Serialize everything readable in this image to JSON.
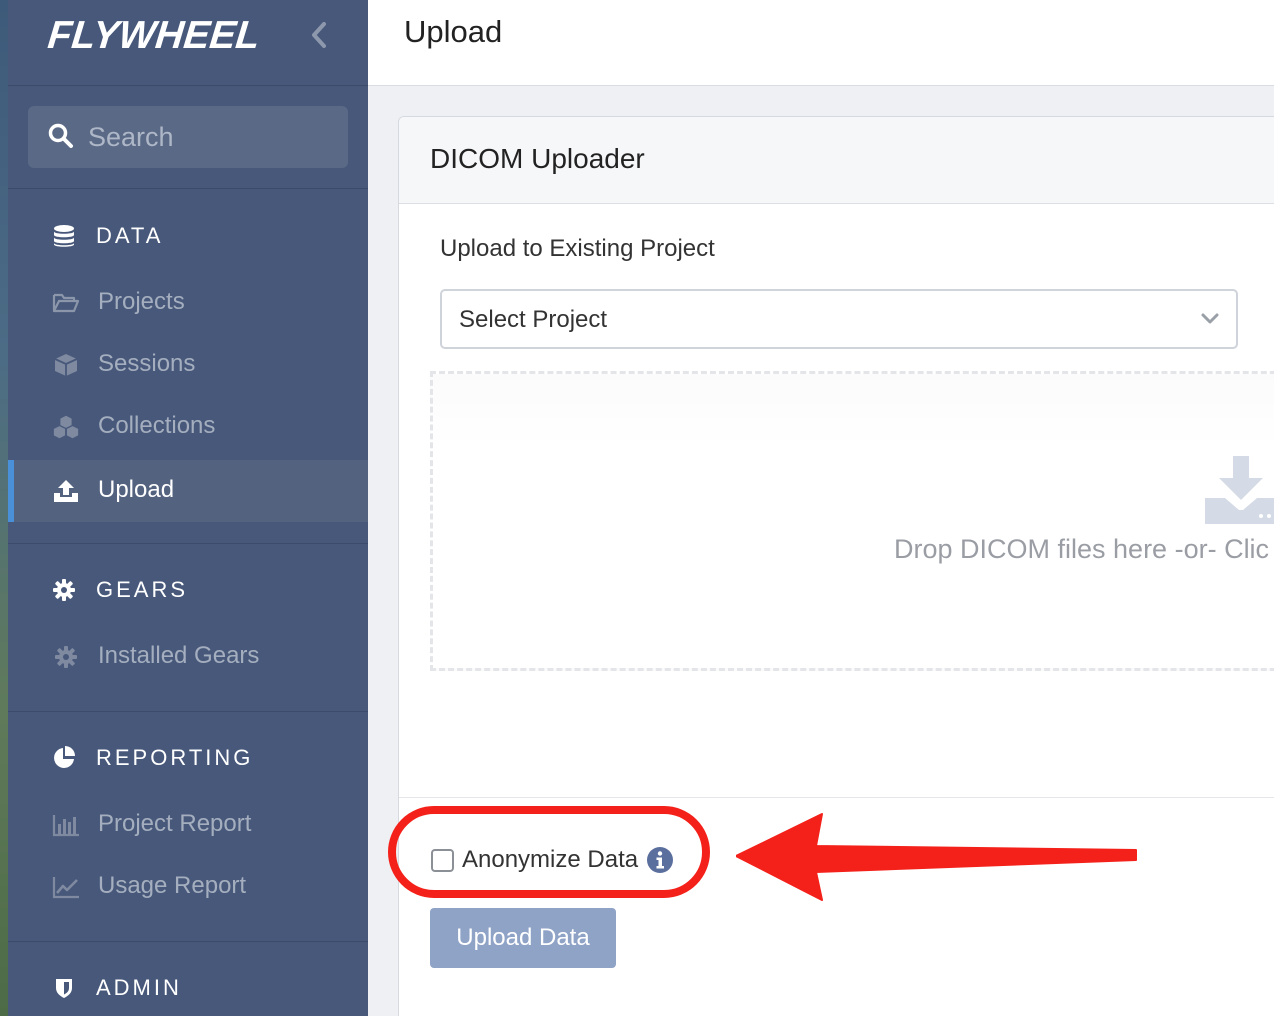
{
  "brand": {
    "logo_text": "FLYWHEEL"
  },
  "search": {
    "placeholder": "Search"
  },
  "sidebar": {
    "sections": [
      {
        "label": "DATA",
        "items": [
          {
            "label": "Projects",
            "icon": "folder-open-icon"
          },
          {
            "label": "Sessions",
            "icon": "cube-icon"
          },
          {
            "label": "Collections",
            "icon": "cubes-icon"
          },
          {
            "label": "Upload",
            "icon": "upload-icon",
            "active": true
          }
        ]
      },
      {
        "label": "GEARS",
        "items": [
          {
            "label": "Installed Gears",
            "icon": "gear-icon"
          }
        ]
      },
      {
        "label": "REPORTING",
        "items": [
          {
            "label": "Project Report",
            "icon": "bar-chart-icon"
          },
          {
            "label": "Usage Report",
            "icon": "line-chart-icon"
          }
        ]
      },
      {
        "label": "ADMIN",
        "items": []
      }
    ]
  },
  "header": {
    "title": "Upload"
  },
  "uploader": {
    "title": "DICOM Uploader",
    "project_label": "Upload to Existing Project",
    "project_select_value": "Select Project",
    "drop_text": "Drop DICOM files here -or- Clic",
    "anonymize_label": "Anonymize Data",
    "anonymize_checked": false,
    "upload_button_label": "Upload Data"
  },
  "colors": {
    "sidebar_bg": "#47587a",
    "active_accent": "#4a90d9",
    "button_disabled": "#8fa3c7",
    "annotation_red": "#f4211a"
  }
}
